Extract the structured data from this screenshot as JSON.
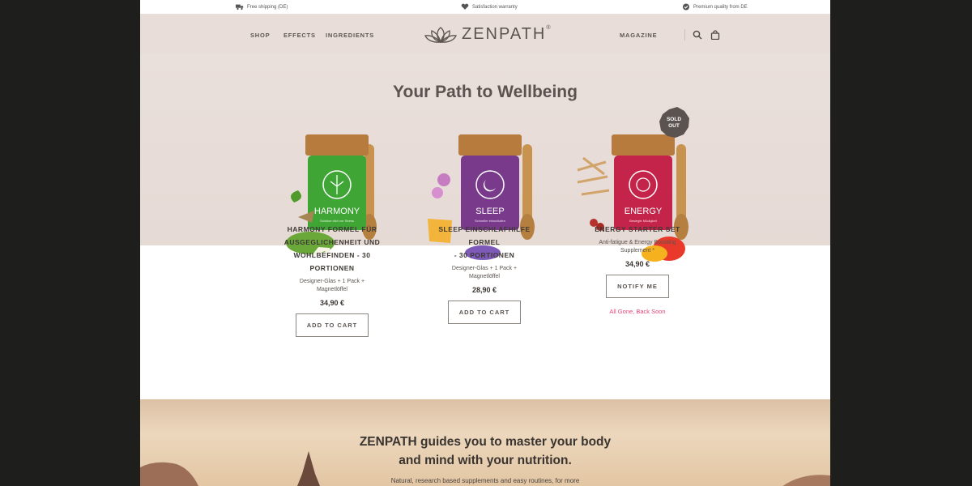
{
  "topbar": {
    "shipping": "Free shipping (DE)",
    "warranty": "Satisfaction warranty",
    "quality": "Premium quality from DE"
  },
  "nav": {
    "shop": "SHOP",
    "effects": "EFFECTS",
    "ingredients": "INGREDIENTS",
    "magazine": "MAGAZINE"
  },
  "brand": {
    "name": "ZENPATH",
    "mark": "®"
  },
  "hero": {
    "title": "Your Path to Wellbeing"
  },
  "products": [
    {
      "name_lines": [
        "HARMONY FORMEL FÜR",
        "AUSGEGLICHENHEIT UND",
        "WOHLBEFINDEN - 30 PORTIONEN"
      ],
      "sub_lines": [
        "Designer-Glas + 1 Pack +",
        "Magnetlöffel"
      ],
      "price": "34,90 €",
      "button": "ADD TO CART",
      "jar_label": "HARMONY",
      "jar_small": "Schütze dich vor Stress",
      "color": "#3fa535"
    },
    {
      "name_lines": [
        "SLEEP EINSCHLAFHILFE FORMEL",
        "- 30 PORTIONEN"
      ],
      "sub_lines": [
        "Designer-Glas + 1 Pack +",
        "Magnetlöffel"
      ],
      "price": "28,90 €",
      "button": "ADD TO CART",
      "jar_label": "SLEEP",
      "jar_small": "Schneller einschlafen",
      "color": "#7a3a8c"
    },
    {
      "name_lines": [
        "ENERGY STARTER SET"
      ],
      "sub_lines": [
        "Anti-fatigue & Energy Boosting",
        "Supplement *"
      ],
      "price": "34,90 €",
      "button": "NOTIFY ME",
      "jar_label": "ENERGY",
      "jar_small": "Besiegte Müdigkeit",
      "color": "#c4244a",
      "badge": [
        "SOLD",
        "OUT"
      ],
      "status": "All Gone, Back Soon"
    }
  ],
  "banner": {
    "title_lines": [
      "ZENPATH guides you to master your body",
      "and mind with your nutrition."
    ],
    "subtitle": "Natural, research based supplements and easy routines, for more"
  },
  "colors": {
    "header_bg": "#e8ddd9",
    "accent_pink": "#e0457a",
    "text": "#4a4440"
  }
}
